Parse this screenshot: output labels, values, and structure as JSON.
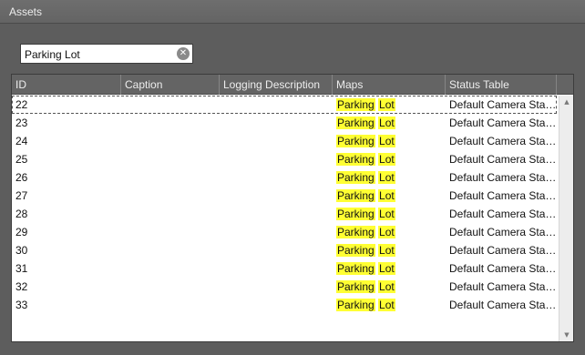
{
  "panel": {
    "title": "Assets"
  },
  "search": {
    "value": "Parking Lot",
    "clear_icon": "clear-circle-icon"
  },
  "columns": [
    "ID",
    "Caption",
    "Logging Description",
    "Maps",
    "Status Table"
  ],
  "highlight_color": "#ffff33",
  "rows": [
    {
      "id": "22",
      "caption": "",
      "logging": "",
      "maps_a": "Parking",
      "maps_b": "Lot",
      "status": "Default Camera Status Table"
    },
    {
      "id": "23",
      "caption": "",
      "logging": "",
      "maps_a": "Parking",
      "maps_b": "Lot",
      "status": "Default Camera Status Table"
    },
    {
      "id": "24",
      "caption": "",
      "logging": "",
      "maps_a": "Parking",
      "maps_b": "Lot",
      "status": "Default Camera Status Table"
    },
    {
      "id": "25",
      "caption": "",
      "logging": "",
      "maps_a": "Parking",
      "maps_b": "Lot",
      "status": "Default Camera Status Table"
    },
    {
      "id": "26",
      "caption": "",
      "logging": "",
      "maps_a": "Parking",
      "maps_b": "Lot",
      "status": "Default Camera Status Table"
    },
    {
      "id": "27",
      "caption": "",
      "logging": "",
      "maps_a": "Parking",
      "maps_b": "Lot",
      "status": "Default Camera Status Table"
    },
    {
      "id": "28",
      "caption": "",
      "logging": "",
      "maps_a": "Parking",
      "maps_b": "Lot",
      "status": "Default Camera Status Table"
    },
    {
      "id": "29",
      "caption": "",
      "logging": "",
      "maps_a": "Parking",
      "maps_b": "Lot",
      "status": "Default Camera Status Table"
    },
    {
      "id": "30",
      "caption": "",
      "logging": "",
      "maps_a": "Parking",
      "maps_b": "Lot",
      "status": "Default Camera Status Table"
    },
    {
      "id": "31",
      "caption": "",
      "logging": "",
      "maps_a": "Parking",
      "maps_b": "Lot",
      "status": "Default Camera Status Table"
    },
    {
      "id": "32",
      "caption": "",
      "logging": "",
      "maps_a": "Parking",
      "maps_b": "Lot",
      "status": "Default Camera Status Table"
    },
    {
      "id": "33",
      "caption": "",
      "logging": "",
      "maps_a": "Parking",
      "maps_b": "Lot",
      "status": "Default Camera Status Table"
    }
  ],
  "selected_row": 0,
  "scroll": {
    "up_icon": "scroll-up-arrow-icon",
    "down_icon": "scroll-down-arrow-icon"
  }
}
